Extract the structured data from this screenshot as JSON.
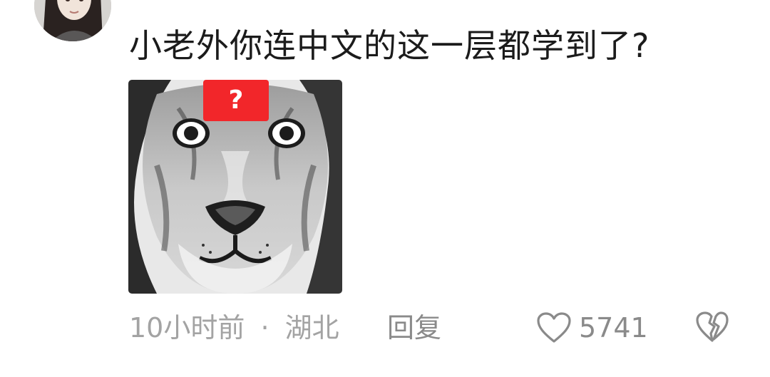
{
  "comment": {
    "text": "小老外你连中文的这一层都学到了?",
    "attachment_badge": "?",
    "time": "10小时前",
    "separator": "·",
    "location": "湖北",
    "reply_label": "回复",
    "like_count": "5741"
  },
  "icons": {
    "like": "heart-outline-icon",
    "dislike": "broken-heart-icon"
  },
  "colors": {
    "text": "#1b1b1b",
    "meta": "#a3a3a3",
    "action": "#8a8a8a",
    "badge": "#f2262a"
  }
}
